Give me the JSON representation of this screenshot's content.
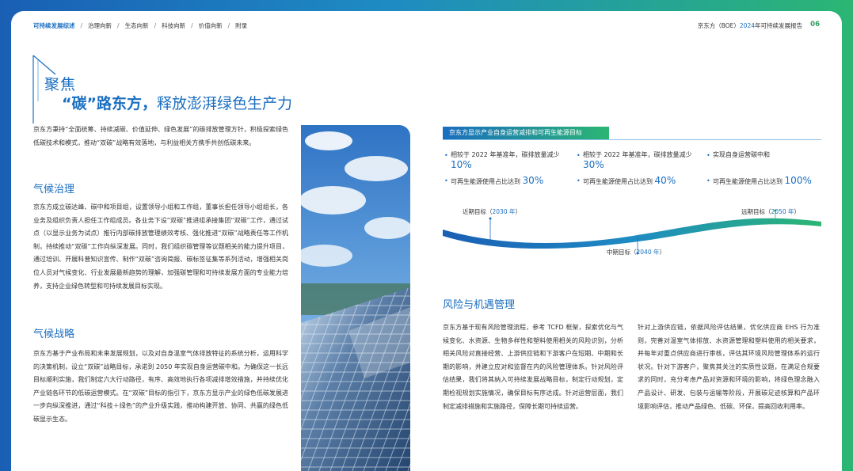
{
  "nav": {
    "items": [
      "可持续发展综述",
      "治理向新",
      "生态向新",
      "科技向新",
      "价值向新",
      "附录"
    ],
    "separator": "/"
  },
  "header": {
    "report_title_prefix": "京东方（BOE）",
    "report_title_year": "2024",
    "report_title_suffix": "年可持续发展报告",
    "page_number": "06"
  },
  "title": {
    "main": "聚焦",
    "sub_strong": "“碳”路东方，",
    "sub_rest": "释放澎湃绿色生产力"
  },
  "intro": "京东方秉持“全面统筹、持续减碳、价值延伸、绿色发展”的碳排放管理方针，积极探索绿色低碳技术和模式，推动“双碳”战略有效落地，与利益相关方携手共创低碳未来。",
  "climate_governance": {
    "heading": "气候治理",
    "body": "京东方成立碳达峰、碳中和项目组，设置领导小组和工作组，董事长担任领导小组组长，各业务及组织负责人担任工作组成员。各业务下设“双碳”推进组承接集团“双碳”工作，通过试点（以显示业务为试点）推行内部碳排放管理绩效考核、强化推进“双碳”战略责任等工作机制，持续推动“双碳”工作向纵深发展。同时，我们组织碳管理等议题相关的能力提升项目，通过培训、开展科普知识宣传、制作“双碳”咨询简报、碳标签征集等系列活动，增强相关岗位人员对气候变化、行业发展最新趋势的理解，加强碳管理和可持续发展方面的专业能力培养，支持企业绿色转型和可持续发展目标实现。"
  },
  "climate_strategy": {
    "heading": "气候战略",
    "body": "京东方基于产业布局和未来发展规划，以及对自身温室气体排放特征的系统分析，运用科学的决策机制，设立“双碳”战略目标，承诺到 2050 年实现自身运营碳中和。为确保这一长远目标顺利实施，我们制定六大行动路径，有序、高效地执行各项减排增效措施，并持续优化产业链各环节的低碳运营模式。在“双碳”目标的指引下，京东方显示产业的绿色低碳发展进一步向纵深推进，通过“科技＋绿色”的产业升级实践，推动构建开放、协同、共赢的绿色低碳显示生态。"
  },
  "targets": {
    "bar_title": "京东方显示产业自身运营减排和可再生能源目标",
    "items": [
      {
        "text": "相较于 2022 年基准年，碳排放量减少",
        "value": "10%"
      },
      {
        "text": "相较于 2022 年基准年，碳排放量减少",
        "value": "30%"
      },
      {
        "text": "实现自身运营碳中和",
        "value": ""
      },
      {
        "text": "可再生能源使用占比达到",
        "value": "30%"
      },
      {
        "text": "可再生能源使用占比达到",
        "value": "40%"
      },
      {
        "text": "可再生能源使用占比达到",
        "value": "100%"
      }
    ],
    "timeline": {
      "near": {
        "label": "近期目标",
        "year": "2030 年"
      },
      "mid": {
        "label": "中期目标",
        "year": "2040 年"
      },
      "long": {
        "label": "远期目标",
        "year": "2050 年"
      }
    }
  },
  "risk": {
    "heading": "风险与机遇管理",
    "body_left": "京东方基于现有风险管理流程，参考 TCFD 框架，探索优化与气候变化、水资源、生物多样性和塑料使用相关的风险识别，分析相关风险对直接经营、上游供应链和下游客户在短期、中期和长期的影响，并建立应对和监督在内的风险管理体系。针对风险评估结果，我们将其纳入可持续发展战略目标，制定行动规划，定期检视规划实施情况，确保目标有序达成。针对运营层面，我们制定减排措施和实施路径，保障长期可持续运营。",
    "body_right": "针对上游供应链，依据风险评估结果，优化供应商 EHS 行为准则，完善对温室气体排放、水资源管理和塑料使用的相关要求，并每年对重点供应商进行审核，评估其环境风险管理体系的运行状况。针对下游客户，聚焦其关注的实质性议题，在满足合规要求的同时，充分考虑产品对资源和环境的影响，将绿色理念融入产品设计、研发、包装与运输等阶段，开展碳足迹核算和产品环境影响评估，推动产品绿色、低碳、环保，提高回收利用率。"
  },
  "colors": {
    "primary_blue": "#1a6ec0",
    "accent_green": "#2bb673"
  }
}
